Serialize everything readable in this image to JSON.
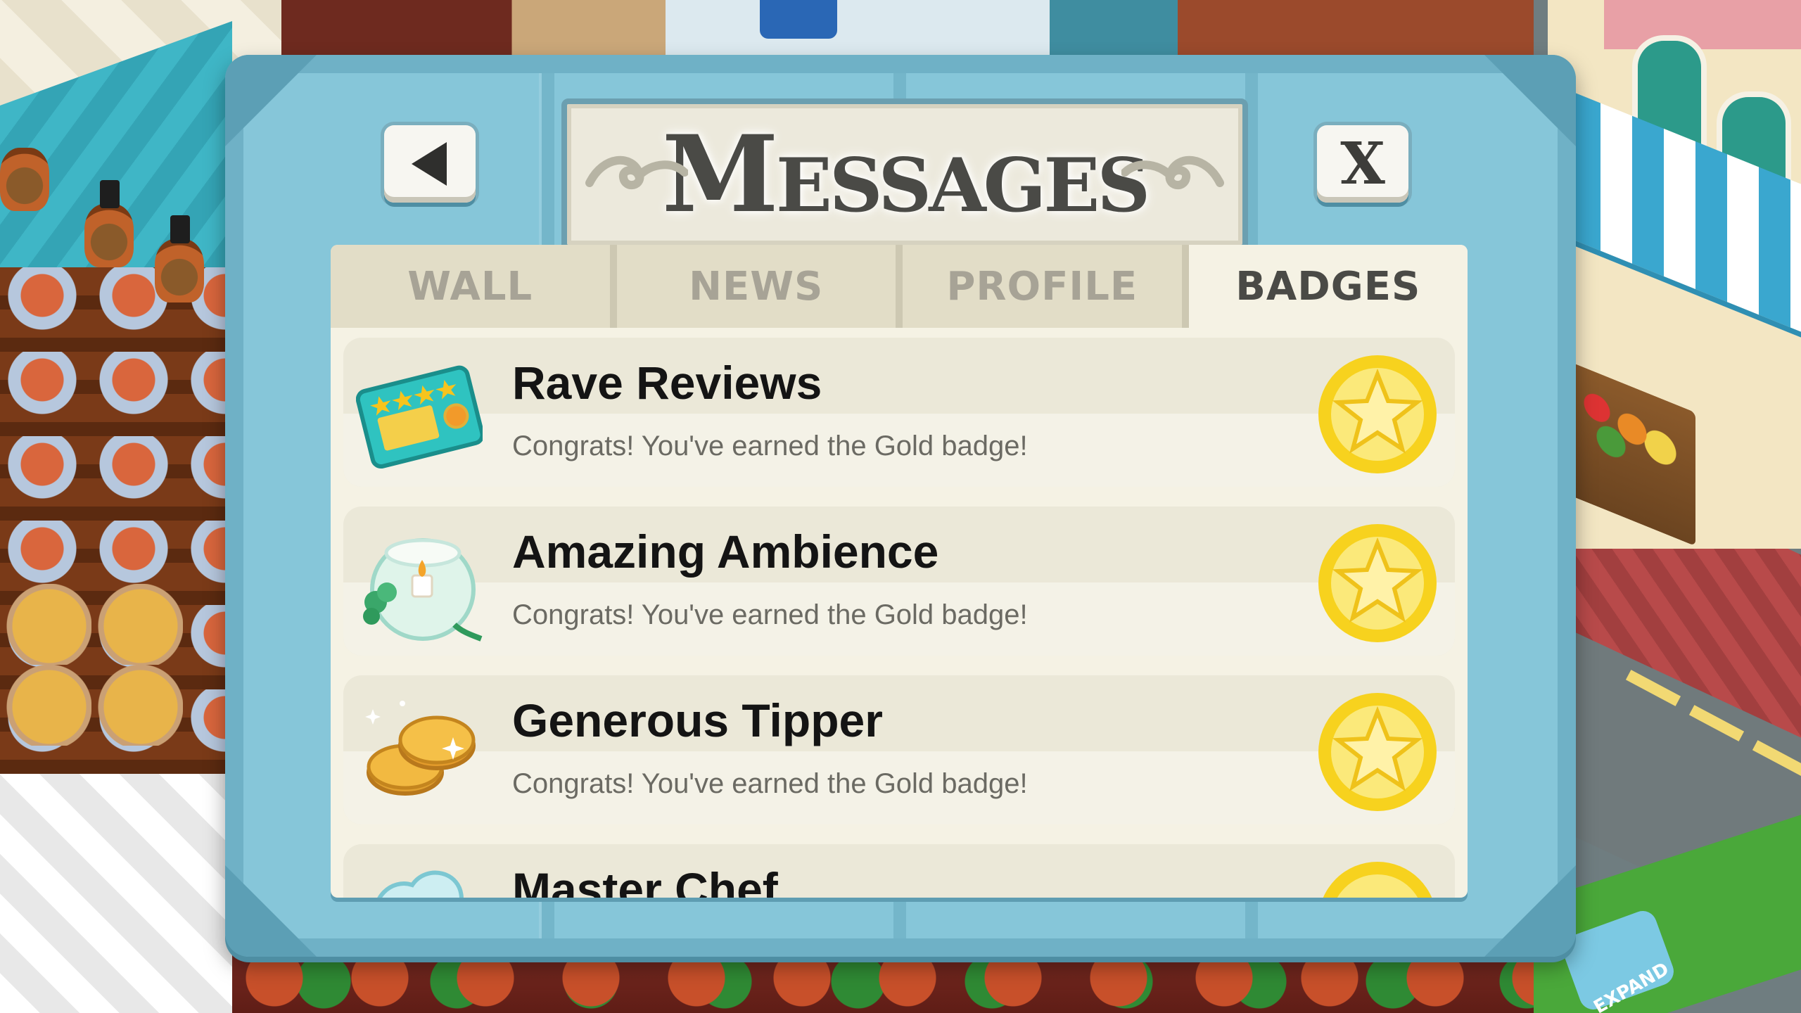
{
  "dialog": {
    "title": "Messages",
    "back_icon": "back-arrow-icon",
    "close_label": "X"
  },
  "tabs": [
    {
      "label": "WALL",
      "active": false
    },
    {
      "label": "NEWS",
      "active": false
    },
    {
      "label": "PROFILE",
      "active": false
    },
    {
      "label": "BADGES",
      "active": true
    }
  ],
  "badges": [
    {
      "title": "Rave Reviews",
      "subtitle": "Congrats! You've earned the Gold badge!",
      "icon": "review-card-icon",
      "badge": "gold-star-badge-icon"
    },
    {
      "title": "Amazing Ambience",
      "subtitle": "Congrats! You've earned the Gold badge!",
      "icon": "candle-bowl-icon",
      "badge": "gold-star-badge-icon"
    },
    {
      "title": "Generous Tipper",
      "subtitle": "Congrats! You've earned the Gold badge!",
      "icon": "gold-coins-icon",
      "badge": "gold-star-badge-icon"
    },
    {
      "title": "Master Chef",
      "subtitle": "",
      "icon": "chef-hat-icon",
      "badge": "gold-star-badge-icon"
    }
  ],
  "scene": {
    "expand_label": "EXPAND"
  },
  "colors": {
    "frame": "#6fb1c6",
    "panel": "#f5f2e4",
    "tab_inactive": "#e2ddc7",
    "gold": "#f4c21a"
  }
}
